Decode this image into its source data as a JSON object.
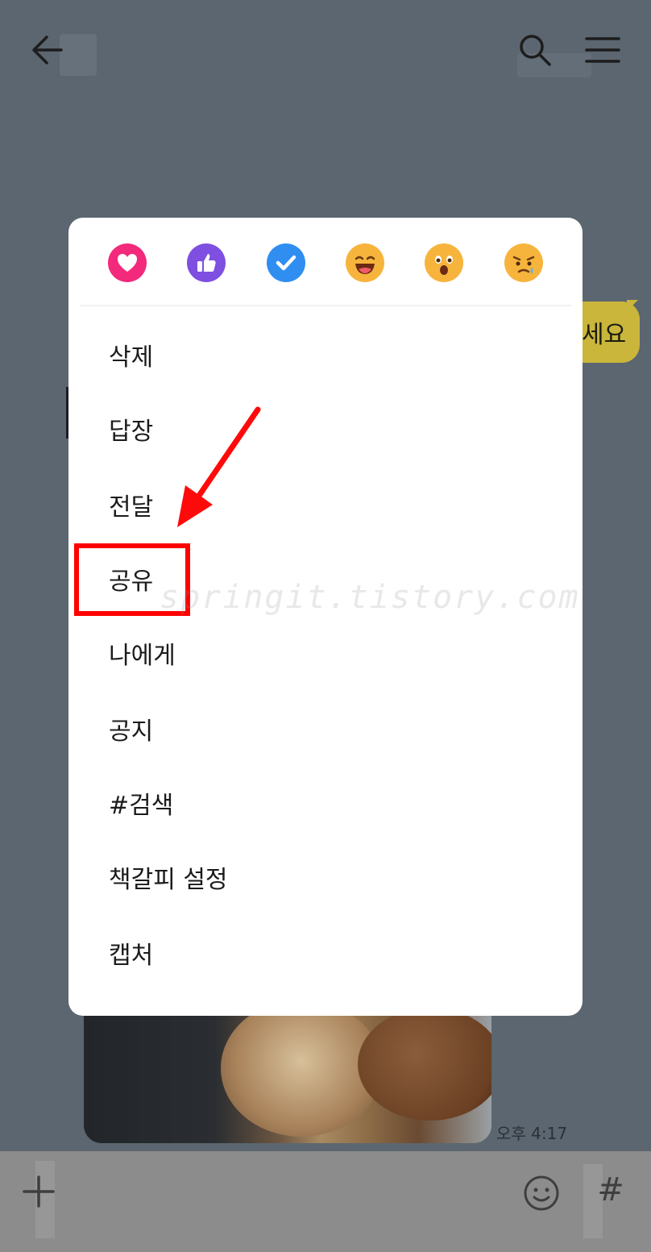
{
  "chat": {
    "bubble_text": "세요",
    "photo_time": "오후 4:17"
  },
  "reactions": [
    {
      "name": "heart",
      "color": "#f3297b"
    },
    {
      "name": "thumbs-up",
      "color": "#7e4fe0"
    },
    {
      "name": "check",
      "color": "#2f8ef0"
    },
    {
      "name": "laughing-face",
      "color": "#f7b43c"
    },
    {
      "name": "surprised-face",
      "color": "#f7b43c"
    },
    {
      "name": "sad-face",
      "color": "#f7b43c"
    }
  ],
  "menu": {
    "items": [
      {
        "label": "삭제"
      },
      {
        "label": "답장"
      },
      {
        "label": "전달"
      },
      {
        "label": "공유"
      },
      {
        "label": "나에게"
      },
      {
        "label": "공지"
      },
      {
        "label": "#검색"
      },
      {
        "label": "책갈피 설정"
      },
      {
        "label": "캡처"
      }
    ]
  },
  "bottom_bar": {
    "hash_label": "#"
  },
  "annotation": {
    "highlight_color": "#ff0000",
    "watermark": "springit.tistory.com"
  }
}
